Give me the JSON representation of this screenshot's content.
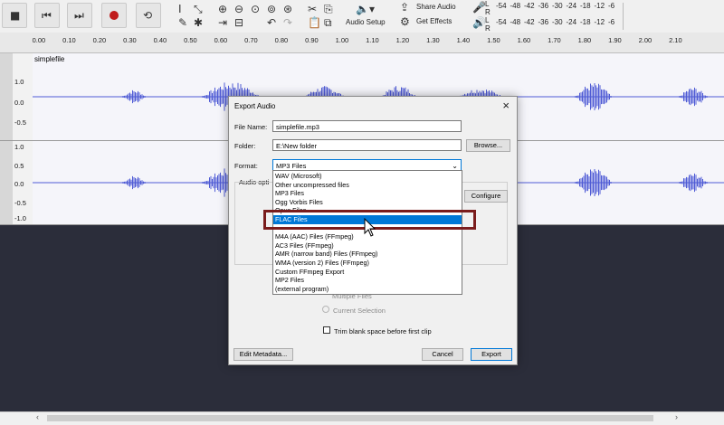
{
  "toolbar": {
    "share_audio": "Share Audio",
    "audio_setup": "Audio Setup",
    "get_effects": "Get Effects",
    "meter_ticks": [
      "-54",
      "-48",
      "-42",
      "-36",
      "-30",
      "-24",
      "-18",
      "-12",
      "-6"
    ],
    "meter_l": "L",
    "meter_r": "R"
  },
  "ruler": {
    "ticks": [
      "0.00",
      "0.10",
      "0.20",
      "0.30",
      "0.40",
      "0.50",
      "0.60",
      "0.70",
      "0.80",
      "0.90",
      "1.00",
      "1.10",
      "1.20",
      "1.30",
      "1.40",
      "1.50",
      "1.60",
      "1.70",
      "1.80",
      "1.90",
      "2.00",
      "2.10"
    ]
  },
  "track": {
    "clip_name": "simplefile",
    "scale": [
      "1.0",
      "0.5",
      "0.0",
      "-0.5",
      "-1.0"
    ]
  },
  "dialog": {
    "title": "Export Audio",
    "close": "×",
    "file_name_label": "File Name:",
    "file_name_value": "simplefile.mp3",
    "folder_label": "Folder:",
    "folder_value": "E:\\New folder",
    "browse": "Browse...",
    "format_label": "Format:",
    "format_value": "MP3 Files",
    "audio_options_label": "Audio opti",
    "configure": "Configure",
    "multiple_files": "Multiple Files",
    "current_selection": "Current Selection",
    "trim_label": "Trim blank space before first clip",
    "edit_metadata": "Edit Metadata...",
    "cancel": "Cancel",
    "export": "Export"
  },
  "format_options": [
    {
      "label": "WAV (Microsoft)",
      "selected": false
    },
    {
      "label": "Other uncompressed files",
      "selected": false
    },
    {
      "label": "MP3 Files",
      "selected": false
    },
    {
      "label": "Ogg Vorbis Files",
      "selected": false
    },
    {
      "label": "Opus Files",
      "selected": false
    },
    {
      "label": "FLAC Files",
      "selected": true
    },
    {
      "label": "",
      "selected": false
    },
    {
      "label": "M4A (AAC) Files (FFmpeg)",
      "selected": false
    },
    {
      "label": "AC3 Files (FFmpeg)",
      "selected": false
    },
    {
      "label": "AMR (narrow band) Files (FFmpeg)",
      "selected": false
    },
    {
      "label": "WMA (version 2) Files (FFmpeg)",
      "selected": false
    },
    {
      "label": "Custom FFmpeg Export",
      "selected": false
    },
    {
      "label": "MP2 Files",
      "selected": false
    },
    {
      "label": "(external program)",
      "selected": false
    }
  ],
  "colors": {
    "waveform": "#4f5bd5",
    "selection": "#0078d7",
    "highlight": "#7a1c1c",
    "background": "#2b2d3a"
  }
}
